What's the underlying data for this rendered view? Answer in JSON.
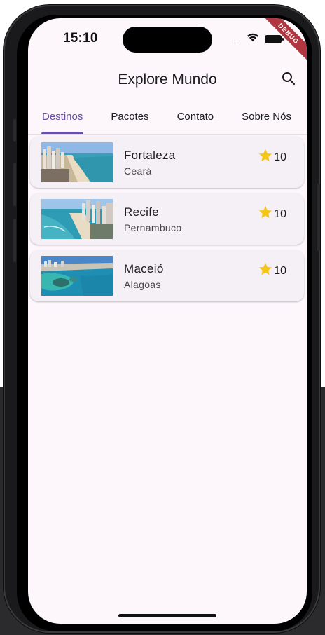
{
  "status_bar": {
    "time": "15:10",
    "signal_dots": "....",
    "icons": [
      "wifi-icon",
      "battery-icon"
    ]
  },
  "debug_banner": {
    "label": "DEBUG",
    "color": "#b0363f"
  },
  "app_bar": {
    "title": "Explore Mundo",
    "action_icon": "search-icon"
  },
  "tabs": [
    {
      "label": "Destinos",
      "active": true
    },
    {
      "label": "Pacotes",
      "active": false
    },
    {
      "label": "Contato",
      "active": false
    },
    {
      "label": "Sobre Nós",
      "active": false
    }
  ],
  "destinations": [
    {
      "name": "Fortaleza",
      "state": "Ceará",
      "rating": "10",
      "image": "city-beach-photo"
    },
    {
      "name": "Recife",
      "state": "Pernambuco",
      "rating": "10",
      "image": "coastline-photo"
    },
    {
      "name": "Maceió",
      "state": "Alagoas",
      "rating": "10",
      "image": "reef-lagoon-photo"
    }
  ],
  "colors": {
    "accent": "#6750a4",
    "background": "#fdf7fc",
    "card": "#f5f0f6",
    "star": "#f5c518"
  }
}
